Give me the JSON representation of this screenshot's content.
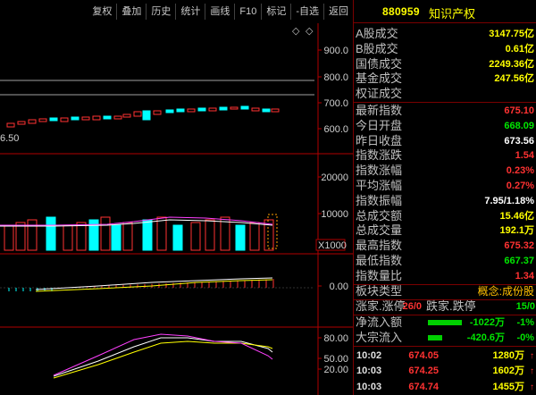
{
  "toolbar": {
    "items": [
      "复权",
      "叠加",
      "历史",
      "统计",
      "画线",
      "F10",
      "标记",
      "-自选",
      "返回"
    ]
  },
  "chart": {
    "price_axis": [
      "900.0",
      "800.0",
      "700.0",
      "600.0"
    ],
    "volume_axis": [
      "20000",
      "10000",
      "X1000"
    ],
    "macd_axis": [
      "0.00"
    ],
    "kdj_axis": [
      "80.00",
      "50.00",
      "20.00"
    ],
    "low_label": "6.50",
    "colors": {
      "up": "#ff3232",
      "down": "#00ffff",
      "axis": "#b00000",
      "grid": "#5a0000"
    }
  },
  "panel": {
    "code": "880959",
    "name": "知识产权",
    "turnover": [
      {
        "label": "A股成交",
        "value": "3147.75亿",
        "color": "yel"
      },
      {
        "label": "B股成交",
        "value": "0.61亿",
        "color": "yel"
      },
      {
        "label": "国债成交",
        "value": "2249.36亿",
        "color": "yel"
      },
      {
        "label": "基金成交",
        "value": "247.56亿",
        "color": "yel"
      },
      {
        "label": "权证成交",
        "value": "",
        "color": "yel"
      }
    ],
    "stats": [
      {
        "label": "最新指数",
        "value": "675.10",
        "color": "red"
      },
      {
        "label": "今日开盘",
        "value": "668.09",
        "color": "grn"
      },
      {
        "label": "昨日收盘",
        "value": "673.56",
        "color": "wht"
      },
      {
        "label": "指数涨跌",
        "value": "1.54",
        "color": "red"
      },
      {
        "label": "指数涨幅",
        "value": "0.23%",
        "color": "red"
      },
      {
        "label": "平均涨幅",
        "value": "0.27%",
        "color": "red"
      },
      {
        "label": "指数振幅",
        "value": "7.95/1.18%",
        "color": "wht"
      },
      {
        "label": "总成交额",
        "value": "15.46亿",
        "color": "yel"
      },
      {
        "label": "总成交量",
        "value": "192.1万",
        "color": "yel"
      },
      {
        "label": "最高指数",
        "value": "675.32",
        "color": "red"
      },
      {
        "label": "最低指数",
        "value": "667.37",
        "color": "grn"
      },
      {
        "label": "指数量比",
        "value": "1.34",
        "color": "red"
      }
    ],
    "sector": {
      "label": "板块类型",
      "value": "概念:成份股"
    },
    "breadth": {
      "up_label": "涨家.涨停",
      "up_value": "26/0",
      "down_label": "跌家.跌停",
      "down_value": "15/0"
    },
    "flows": [
      {
        "label": "净流入额",
        "value": "-1022万",
        "pct": "-1%"
      },
      {
        "label": "大宗流入",
        "value": "-420.6万",
        "pct": "-0%"
      }
    ],
    "ticks": [
      {
        "time": "10:02",
        "price": "674.05",
        "vol": "1280万",
        "dir": "↑"
      },
      {
        "time": "10:03",
        "price": "674.25",
        "vol": "1602万",
        "dir": "↑"
      },
      {
        "time": "10:03",
        "price": "674.74",
        "vol": "1455万",
        "dir": "↑"
      }
    ]
  }
}
